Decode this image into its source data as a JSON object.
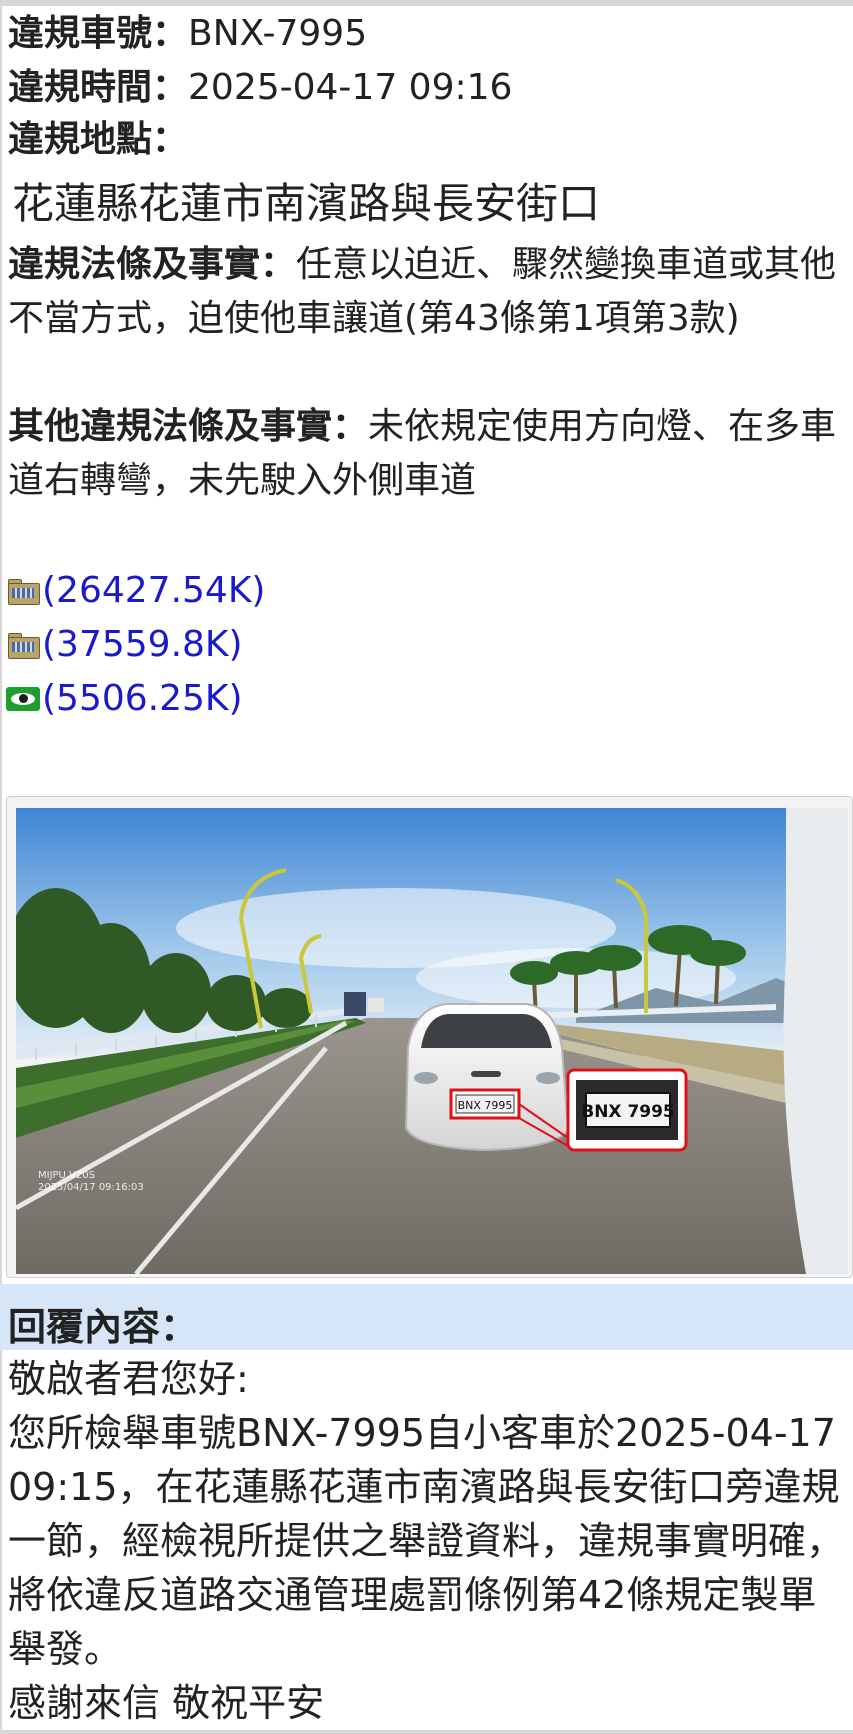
{
  "report": {
    "plate_label": "違規車號：",
    "plate_value": "BNX-7995",
    "time_label": "違規時間：",
    "time_value": "2025-04-17 09:16",
    "place_label": "違規地點：",
    "place_value": "花蓮縣花蓮市南濱路與長安街口",
    "law_label": "違規法條及事實：",
    "law_value": "任意以迫近、驟然變換車道或其他不當方式，迫使他車讓道(第43條第1項第3款)",
    "other_label": "其他違規法條及事實：",
    "other_value": "未依規定使用方向燈、在多車道右轉彎，未先駛入外側車道"
  },
  "attachments": [
    {
      "icon": "video-file-icon",
      "size": "(26427.54K)"
    },
    {
      "icon": "video-file-icon",
      "size": "(37559.8K)"
    },
    {
      "icon": "image-view-icon",
      "size": "(5506.25K)"
    }
  ],
  "photo": {
    "inset_plate": "BNX 7995",
    "car_plate": "BNX 7995",
    "camera_brand": "MIJPU V20S",
    "camera_stamp": "2025/04/17 09:16:03"
  },
  "reply": {
    "heading": "回覆內容：",
    "greeting": "敬啟者君您好:",
    "body": "您所檢舉車號BNX-7995自小客車於2025-04-17 09:15，在花蓮縣花蓮市南濱路與長安街口旁違規一節，經檢視所提供之舉證資料，違規事實明確，將依違反道路交通管理處罰條例第42條規定製單舉發。",
    "closing": "感謝來信 敬祝平安"
  },
  "colors": {
    "link": "#1a1acc",
    "reply_header_bg": "#d6e6f8",
    "highlight_red": "#e0101a"
  }
}
